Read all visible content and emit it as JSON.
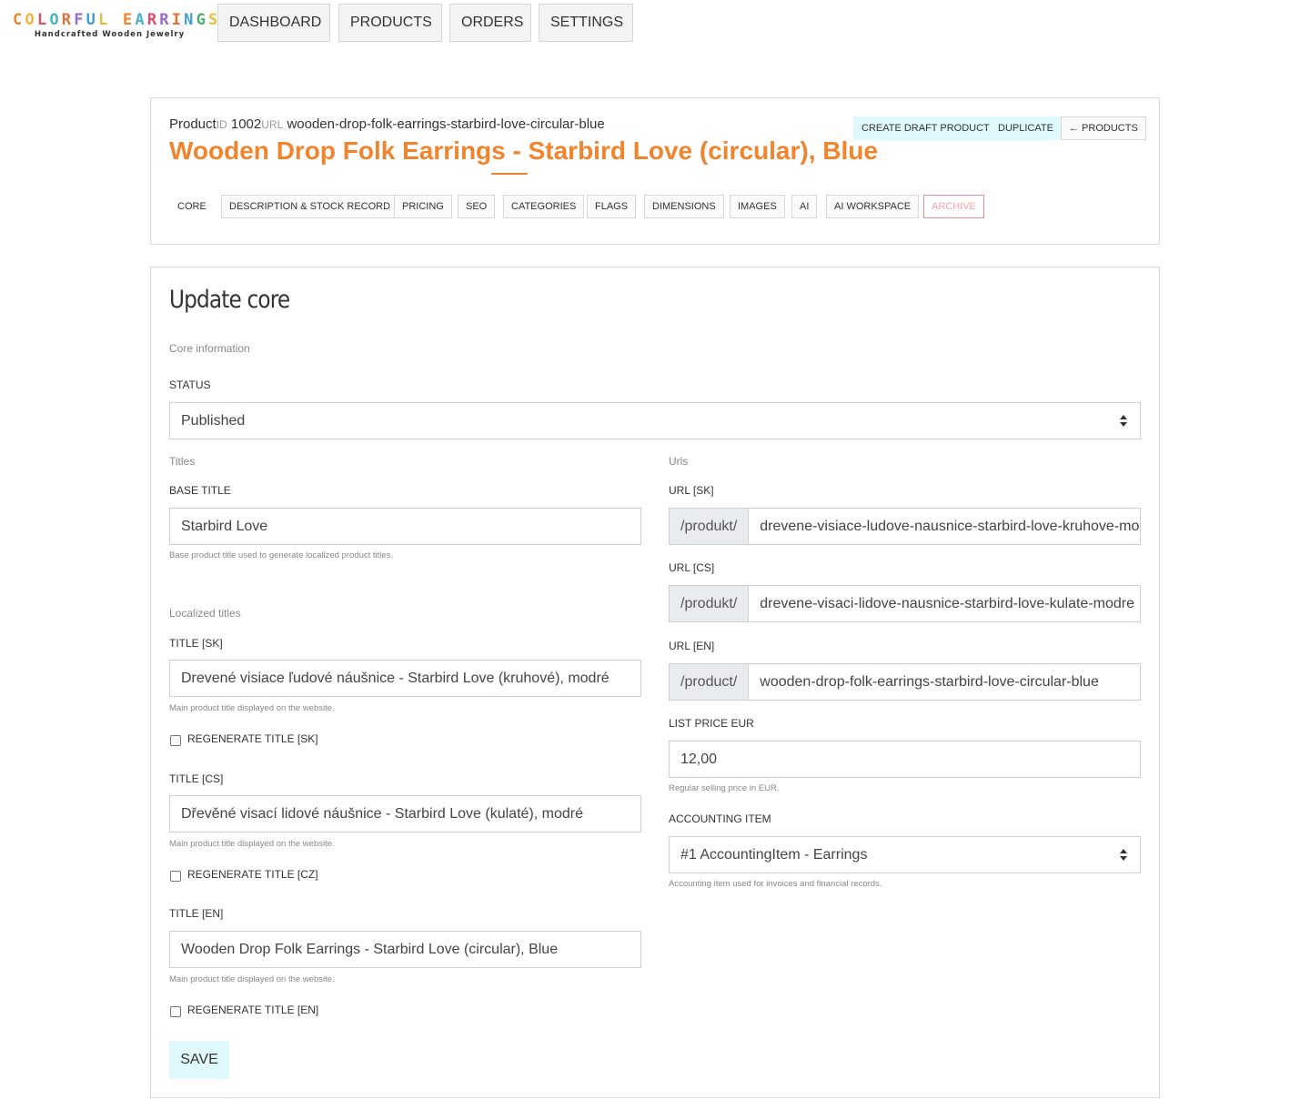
{
  "brand": {
    "name_letters": [
      "C",
      "O",
      "L",
      "O",
      "R",
      "F",
      "U",
      "L",
      " ",
      "E",
      "A",
      "R",
      "R",
      "I",
      "N",
      "G",
      "S"
    ],
    "letter_colors": [
      "#f0852d",
      "#f3b33d",
      "#d94f6a",
      "#47b4c8",
      "#e2713b",
      "#9a6ac9",
      "#3e9fd8",
      "#e9bd3a",
      "",
      "#f0852d",
      "#47b4c8",
      "#d94f6a",
      "#9a6ac9",
      "#e2713b",
      "#3e9fd8",
      "#4db06f",
      "#e9bd3a"
    ],
    "tagline": "Handcrafted Wooden Jewelry"
  },
  "nav": {
    "dashboard": "DASHBOARD",
    "products": "PRODUCTS",
    "orders": "ORDERS",
    "settings": "SETTINGS"
  },
  "product": {
    "meta_product": "Product",
    "meta_id_label": "ID",
    "meta_id": "1002",
    "meta_url_label": "URL",
    "meta_url": "wooden-drop-folk-earrings-starbird-love-circular-blue",
    "title": "Wooden Drop Folk Earrings - Starbird Love (circular), Blue",
    "accent_color": "#f0852d"
  },
  "actions": {
    "create_draft": "CREATE DRAFT PRODUCT",
    "duplicate": "DUPLICATE",
    "back_products": "← PRODUCTS"
  },
  "tabs": {
    "core": "CORE",
    "description": "DESCRIPTION & STOCK RECORD",
    "pricing": "PRICING",
    "seo": "SEO",
    "categories": "CATEGORIES",
    "flags": "FLAGS",
    "dimensions": "DIMENSIONS",
    "images": "IMAGES",
    "ai": "AI",
    "ai_workspace": "AI WORKSPACE",
    "archive": "ARCHIVE"
  },
  "form": {
    "title": "Update core",
    "core_info": "Core information",
    "status_label": "STATUS",
    "status_value": "Published",
    "titles_section": "Titles",
    "base_title_label": "BASE TITLE",
    "base_title_value": "Starbird Love",
    "base_title_help": "Base product title used to generate localized product titles.",
    "localized_section": "Localized titles",
    "title_sk_label": "TITLE [SK]",
    "title_sk_value": "Drevené visiace ľudové náušnice - Starbird Love (kruhové), modré",
    "title_sk_help": "Main product title displayed on the website.",
    "regen_sk": "REGENERATE TITLE [SK]",
    "title_cs_label": "TITLE [CS]",
    "title_cs_value": "Dřevěné visací lidové náušnice - Starbird Love (kulaté), modré",
    "title_cs_help": "Main product title displayed on the website.",
    "regen_cz": "REGENERATE TITLE [CZ]",
    "title_en_label": "TITLE [EN]",
    "title_en_value": "Wooden Drop Folk Earrings - Starbird Love (circular), Blue",
    "title_en_help": "Main product title displayed on the website.",
    "regen_en": "REGENERATE TITLE [EN]",
    "urls_section": "Urls",
    "url_sk_label": "URL [SK]",
    "url_sk_prefix": "/produkt/",
    "url_sk_value": "drevene-visiace-ludove-nausnice-starbird-love-kruhove-modre",
    "url_cs_label": "URL [CS]",
    "url_cs_prefix": "/produkt/",
    "url_cs_value": "drevene-visaci-lidove-nausnice-starbird-love-kulate-modre",
    "url_en_label": "URL [EN]",
    "url_en_prefix": "/product/",
    "url_en_value": "wooden-drop-folk-earrings-starbird-love-circular-blue",
    "list_price_label": "LIST PRICE EUR",
    "list_price_value": "12,00",
    "list_price_help": "Regular selling price in EUR.",
    "accounting_label": "ACCOUNTING ITEM",
    "accounting_value": "#1 AccountingItem - Earrings",
    "accounting_help": "Accounting item used for invoices and financial records.",
    "save": "SAVE"
  }
}
